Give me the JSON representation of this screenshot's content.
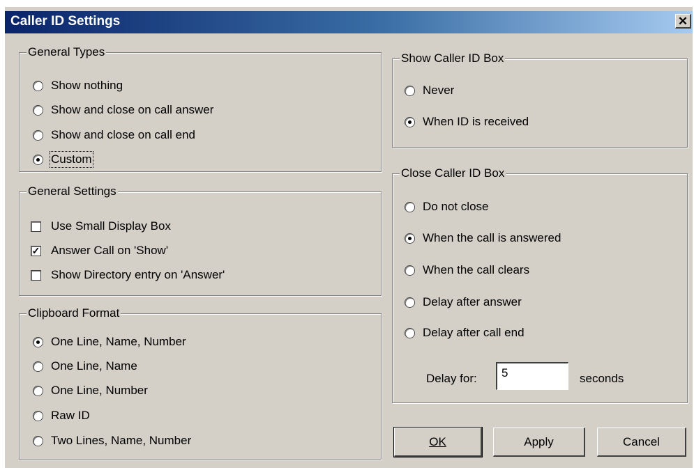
{
  "window": {
    "title": "Caller ID Settings",
    "close_glyph": "✕"
  },
  "general_types": {
    "legend": "General Types",
    "options": [
      {
        "label": "Show nothing",
        "selected": false
      },
      {
        "label": "Show and close on call answer",
        "selected": false
      },
      {
        "label": "Show and close on call end",
        "selected": false
      },
      {
        "label": "Custom",
        "selected": true
      }
    ]
  },
  "general_settings": {
    "legend": "General Settings",
    "options": [
      {
        "label": "Use Small Display Box",
        "checked": false
      },
      {
        "label": "Answer Call on 'Show'",
        "checked": true
      },
      {
        "label": "Show Directory entry on 'Answer'",
        "checked": false
      }
    ]
  },
  "clipboard_format": {
    "legend": "Clipboard Format",
    "options": [
      {
        "label": "One Line, Name, Number",
        "selected": true
      },
      {
        "label": "One Line, Name",
        "selected": false
      },
      {
        "label": "One Line, Number",
        "selected": false
      },
      {
        "label": "Raw ID",
        "selected": false
      },
      {
        "label": "Two Lines, Name, Number",
        "selected": false
      }
    ]
  },
  "show_box": {
    "legend": "Show Caller ID Box",
    "options": [
      {
        "label": "Never",
        "selected": false
      },
      {
        "label": "When ID is received",
        "selected": true
      }
    ]
  },
  "close_box": {
    "legend": "Close Caller ID Box",
    "options": [
      {
        "label": "Do not close",
        "selected": false
      },
      {
        "label": "When the call is answered",
        "selected": true
      },
      {
        "label": "When the call clears",
        "selected": false
      },
      {
        "label": "Delay after answer",
        "selected": false
      },
      {
        "label": "Delay after call end",
        "selected": false
      }
    ],
    "delay_label": "Delay for:",
    "delay_value": "5",
    "delay_unit": "seconds"
  },
  "buttons": {
    "ok": "OK",
    "apply": "Apply",
    "cancel": "Cancel"
  }
}
